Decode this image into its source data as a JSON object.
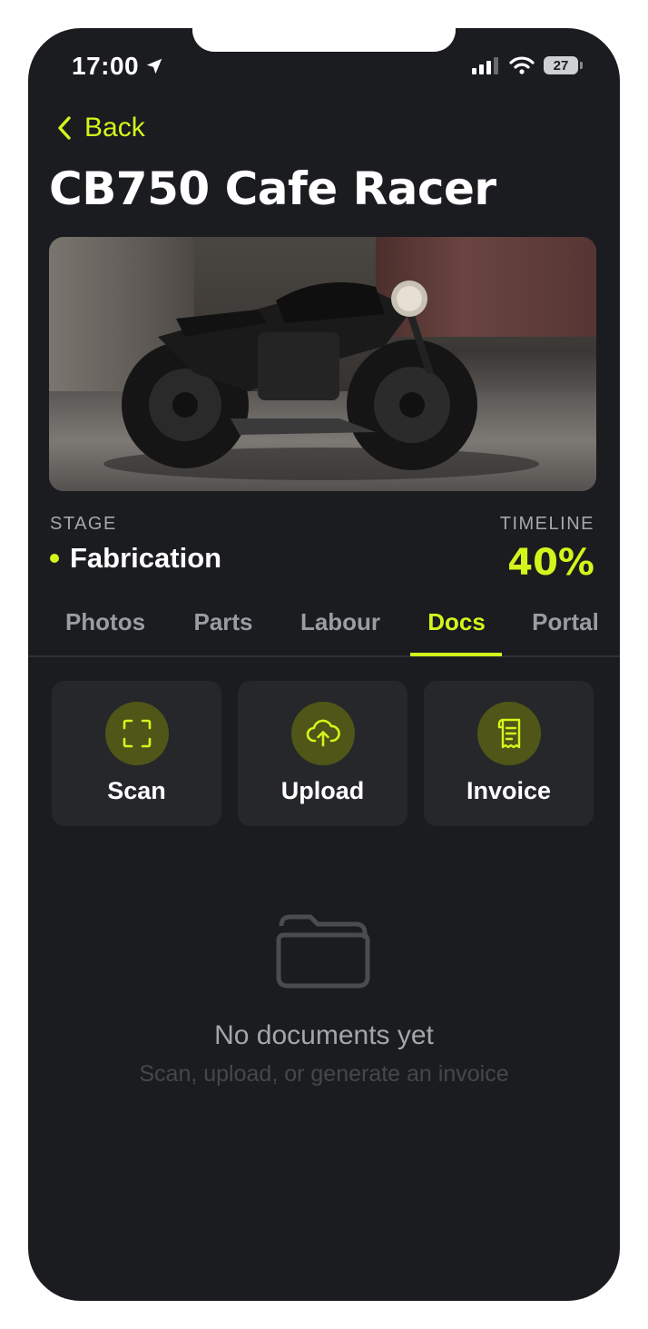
{
  "status_bar": {
    "time": "17:00",
    "battery": "27",
    "icons": [
      "location-arrow-icon",
      "cellular-signal-icon",
      "wifi-icon",
      "battery-icon"
    ]
  },
  "nav": {
    "back_label": "Back"
  },
  "project": {
    "title": "CB750 Cafe Racer",
    "image": "cafe racer motorcycle photo",
    "stage_label": "STAGE",
    "stage_value": "Fabrication",
    "timeline_label": "TIMELINE",
    "timeline_value": "40%"
  },
  "tabs": [
    {
      "label": "Photos",
      "active": false
    },
    {
      "label": "Parts",
      "active": false
    },
    {
      "label": "Labour",
      "active": false
    },
    {
      "label": "Docs",
      "active": true
    },
    {
      "label": "Portal",
      "active": false
    }
  ],
  "actions": [
    {
      "label": "Scan",
      "icon": "scan-icon"
    },
    {
      "label": "Upload",
      "icon": "cloud-upload-icon"
    },
    {
      "label": "Invoice",
      "icon": "receipt-icon"
    }
  ],
  "empty_state": {
    "icon": "folder-icon",
    "title": "No documents yet",
    "subtitle": "Scan, upload, or generate an invoice"
  },
  "colors": {
    "accent": "#d4f51b",
    "background": "#1b1c1f",
    "card": "#26272a",
    "icon_circle": "#4f5618"
  }
}
